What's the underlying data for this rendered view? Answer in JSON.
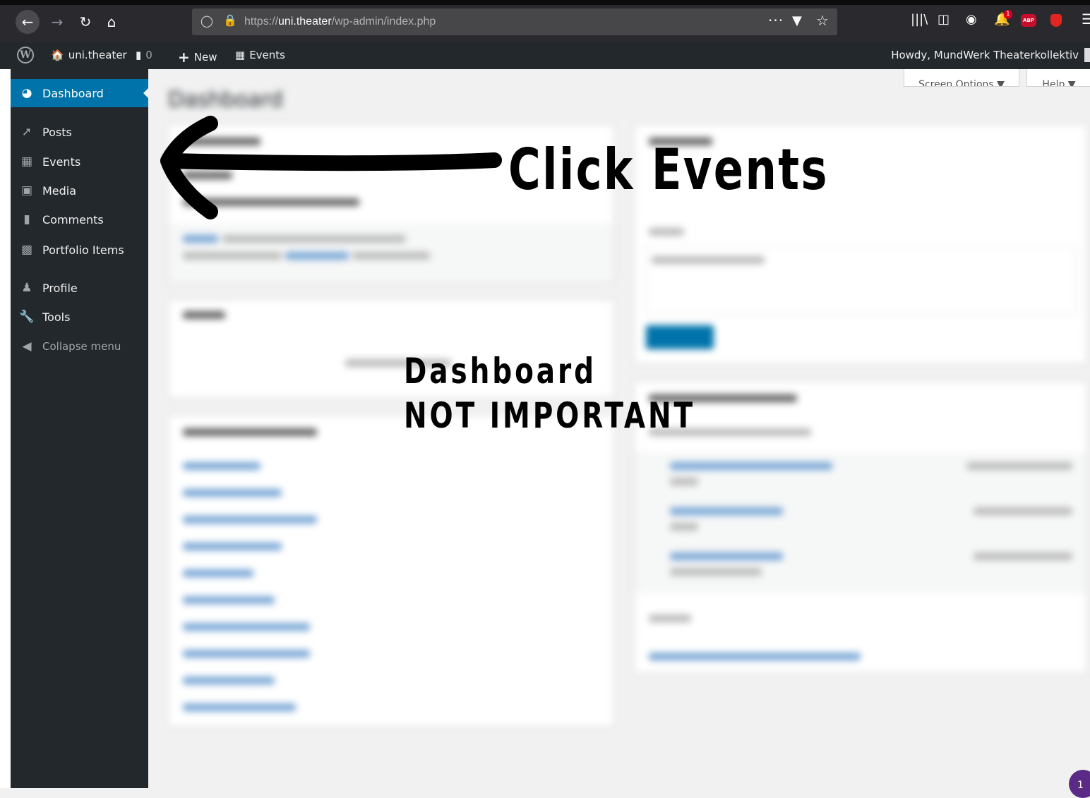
{
  "browser": {
    "url_scheme_prefix": "https://",
    "url_host": "uni.theater",
    "url_path": "/wp-admin/index.php",
    "more_label": "···",
    "notification_badge": "1",
    "abp_label": "ABP",
    "icons": [
      "back-icon",
      "forward-icon",
      "reload-icon",
      "home-icon",
      "shield-icon",
      "lock-icon",
      "pocket-icon",
      "bookmark-star-icon",
      "library-icon",
      "sidebar-icon",
      "extension-icon",
      "notification-bell-icon",
      "adblock-plus-icon",
      "ublock-icon",
      "hamburger-menu-icon"
    ]
  },
  "adminbar": {
    "site_name": "uni.theater",
    "comments_count": "0",
    "new_label": "New",
    "events_label": "Events",
    "howdy": "Howdy, MundWerk Theaterkollektiv"
  },
  "sidebar": {
    "items": [
      {
        "label": "Dashboard",
        "icon": "dashboard-icon",
        "active": true
      },
      {
        "label": "Posts",
        "icon": "pin-icon"
      },
      {
        "label": "Events",
        "icon": "calendar-icon"
      },
      {
        "label": "Media",
        "icon": "media-icon"
      },
      {
        "label": "Comments",
        "icon": "comment-icon"
      },
      {
        "label": "Portfolio Items",
        "icon": "portfolio-icon"
      },
      {
        "label": "Profile",
        "icon": "user-icon"
      },
      {
        "label": "Tools",
        "icon": "wrench-icon"
      },
      {
        "label": "Collapse menu",
        "icon": "collapse-icon"
      }
    ]
  },
  "dashboard": {
    "title": "Dashboard",
    "screen_options": "Screen Options ▼",
    "help": "Help ▼"
  },
  "annotations": {
    "click_events": "Click Events",
    "dashboard_line1": "Dashboard",
    "dashboard_line2": "NOT IMPORTANT"
  },
  "notification_bubble": "1",
  "colors": {
    "admin_dark": "#23282d",
    "active_blue": "#0073aa",
    "browser_dark": "#2a2a2e"
  }
}
